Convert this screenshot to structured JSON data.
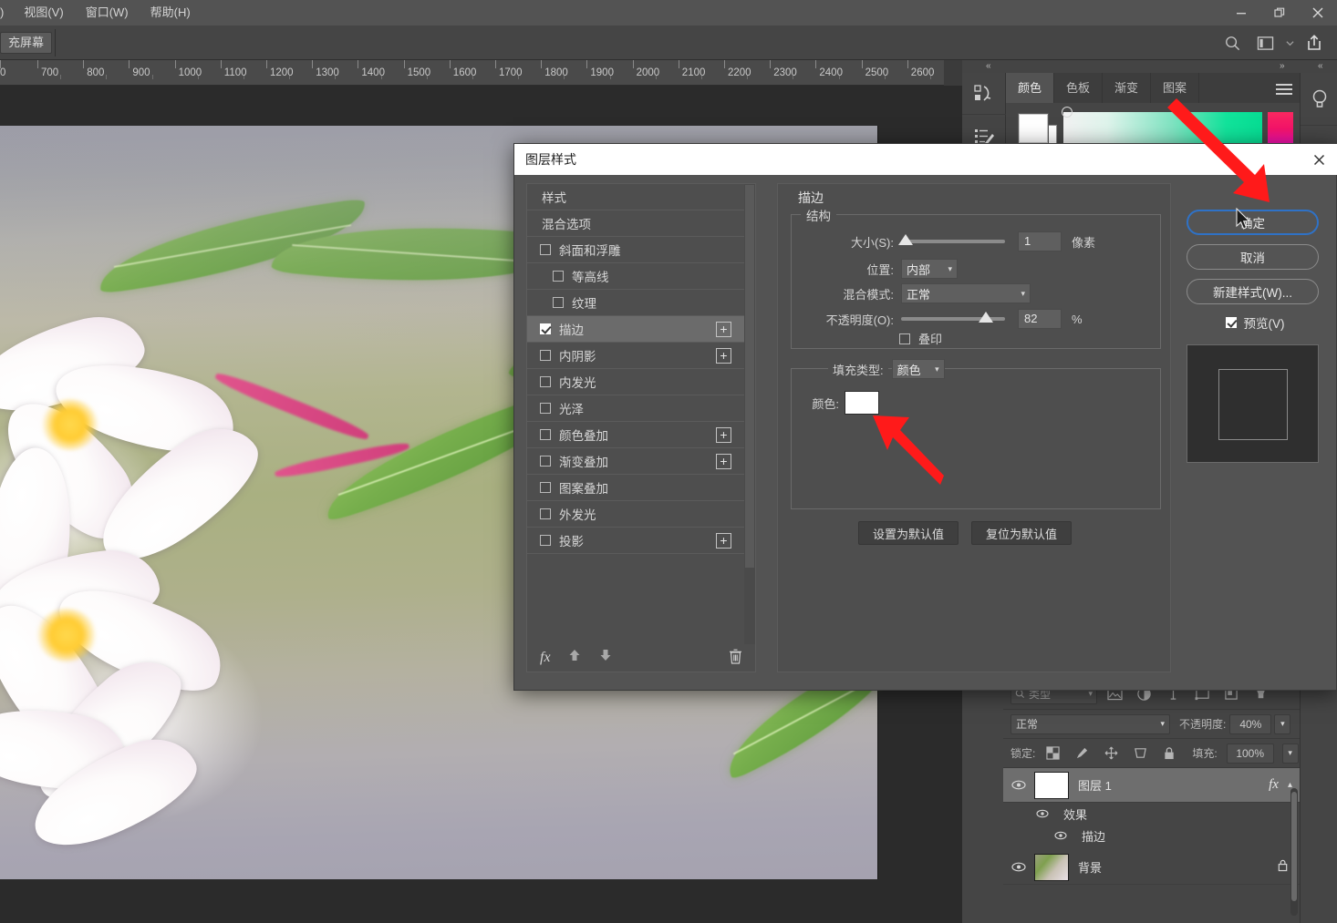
{
  "app": {
    "menubar": [
      "视图(V)",
      "窗口(W)",
      "帮助(H)"
    ],
    "menu_clipped": ")",
    "window_controls": {
      "minimize": "minimize",
      "restore": "restore",
      "close": "close"
    }
  },
  "options_bar": {
    "screen_mode_button": "充屏幕",
    "icons": [
      "search-icon",
      "workspace-icon",
      "chevron-down-icon",
      "share-icon"
    ]
  },
  "ruler": {
    "unit_labels": [
      "700",
      "800",
      "900",
      "1000",
      "1100",
      "1200",
      "1300",
      "1400",
      "1500",
      "1600",
      "1700",
      "1800",
      "1900",
      "2000",
      "2100",
      "2200",
      "2300",
      "2400",
      "2500",
      "2600"
    ],
    "first_partial": "0"
  },
  "color_panel": {
    "tabs": [
      "颜色",
      "色板",
      "渐变",
      "图案"
    ],
    "active_tab": "颜色",
    "menu_icon": "hamburger-icon",
    "foreground": "#ffffff",
    "background": "#ffffff",
    "spectrum_colors": [
      "#f2f2f2",
      "#12e39b",
      "#f4136a",
      "#ef0fd0"
    ]
  },
  "layers_panel": {
    "filter_placeholder": "类型",
    "filter_icons": [
      "image-filter-icon",
      "adjustment-filter-icon",
      "text-filter-icon",
      "shape-filter-icon",
      "smartobject-filter-icon",
      "toggle-filter-icon"
    ],
    "blend_mode": "正常",
    "opacity_label": "不透明度:",
    "opacity_value": "40%",
    "lock_label": "锁定:",
    "lock_icons": [
      "transparency-lock-icon",
      "paint-lock-icon",
      "move-lock-icon",
      "artboard-lock-icon",
      "all-lock-icon"
    ],
    "fill_label": "填充:",
    "fill_value": "100%",
    "rows": [
      {
        "name": "图层 1",
        "thumb": "checker",
        "fx_badge": "fx",
        "selected": true,
        "locked": false
      },
      {
        "name": "效果",
        "kind": "effects-group"
      },
      {
        "name": "描边",
        "kind": "effect-item"
      },
      {
        "name": "背景",
        "thumb": "photo",
        "selected": false,
        "locked": true
      }
    ]
  },
  "dialog": {
    "title": "图层样式",
    "close_icon": "close-icon",
    "style_list": {
      "items": [
        {
          "label": "样式",
          "type": "plain"
        },
        {
          "label": "混合选项",
          "type": "plain"
        },
        {
          "label": "斜面和浮雕",
          "type": "check",
          "checked": false,
          "plus": false
        },
        {
          "label": "等高线",
          "type": "check",
          "checked": false,
          "indent": true,
          "plus": false
        },
        {
          "label": "纹理",
          "type": "check",
          "checked": false,
          "indent": true,
          "plus": false
        },
        {
          "label": "描边",
          "type": "check",
          "checked": true,
          "plus": true,
          "active": true
        },
        {
          "label": "内阴影",
          "type": "check",
          "checked": false,
          "plus": true
        },
        {
          "label": "内发光",
          "type": "check",
          "checked": false,
          "plus": false
        },
        {
          "label": "光泽",
          "type": "check",
          "checked": false,
          "plus": false
        },
        {
          "label": "颜色叠加",
          "type": "check",
          "checked": false,
          "plus": true
        },
        {
          "label": "渐变叠加",
          "type": "check",
          "checked": false,
          "plus": true
        },
        {
          "label": "图案叠加",
          "type": "check",
          "checked": false,
          "plus": false
        },
        {
          "label": "外发光",
          "type": "check",
          "checked": false,
          "plus": false
        },
        {
          "label": "投影",
          "type": "check",
          "checked": false,
          "plus": true
        }
      ],
      "footer": {
        "fx_label": "fx",
        "up_icon": "move-up-icon",
        "down_icon": "move-down-icon",
        "delete_icon": "trash-icon"
      }
    },
    "panel": {
      "section_title": "描边",
      "structure_group": "结构",
      "size_label": "大小(S):",
      "size_value": "1",
      "size_unit": "像素",
      "size_slider_percent": 2,
      "position_label": "位置:",
      "position_value": "内部",
      "blend_label": "混合模式:",
      "blend_value": "正常",
      "opacity_label": "不透明度(O):",
      "opacity_value": "82",
      "opacity_unit": "%",
      "opacity_slider_percent": 82,
      "overprint_label": "叠印",
      "overprint_checked": false,
      "fill_type_label": "填充类型:",
      "fill_type_value": "颜色",
      "color_label": "颜色:",
      "color_value": "#ffffff",
      "set_default_button": "设置为默认值",
      "reset_default_button": "复位为默认值"
    },
    "buttons": {
      "ok": "确定",
      "cancel": "取消",
      "new_style": "新建样式(W)...",
      "preview_label": "预览(V)",
      "preview_checked": true
    }
  },
  "annotations": {
    "arrow_color": "#ff1a1a",
    "arrows": [
      "arrow-to-ok-button",
      "arrow-to-color-chip"
    ]
  }
}
